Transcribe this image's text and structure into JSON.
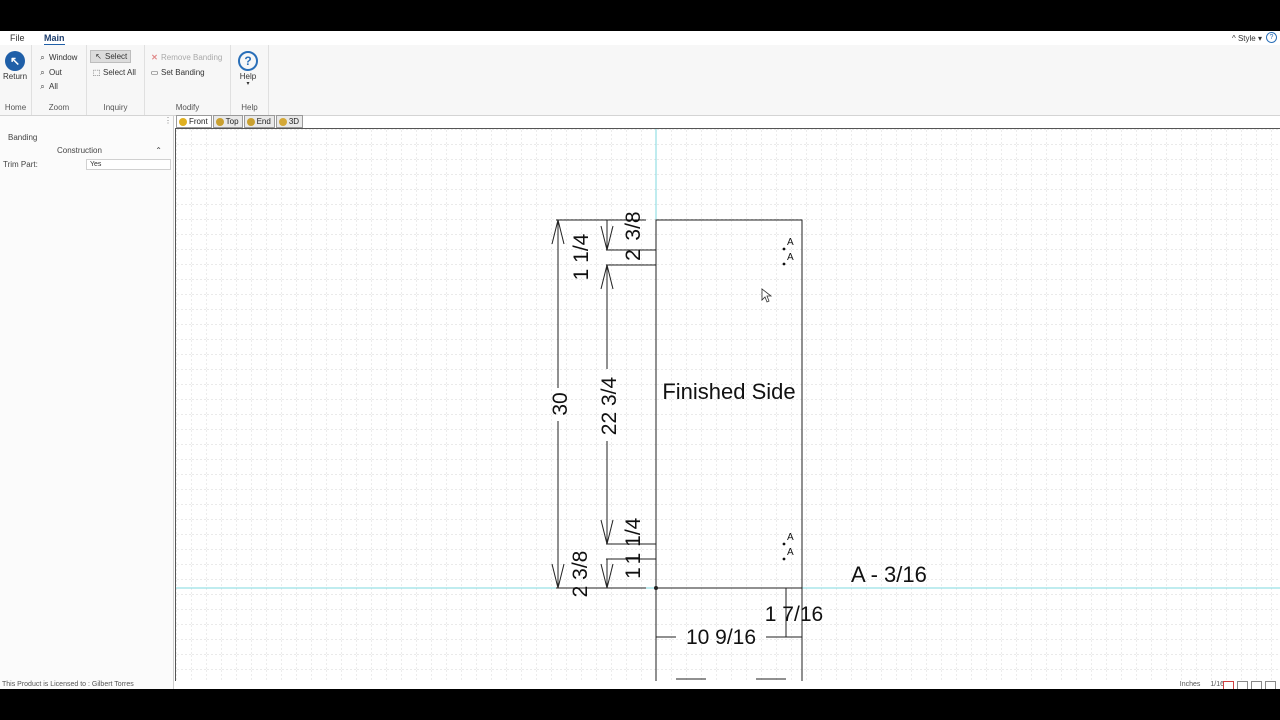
{
  "menu": {
    "file": "File",
    "main": "Main",
    "style": "Style"
  },
  "ribbon": {
    "home": {
      "return_label": "Return",
      "group_label": "Home"
    },
    "zoom": {
      "window": "Window",
      "out": "Out",
      "all": "All",
      "group_label": "Zoom"
    },
    "inquiry": {
      "select": "Select",
      "select_all": "Select All",
      "group_label": "Inquiry"
    },
    "modify": {
      "remove_banding": "Remove Banding",
      "set_banding": "Set Banding",
      "group_label": "Modify"
    },
    "help": {
      "help_label": "Help",
      "group_label": "Help"
    }
  },
  "panel": {
    "title": "Banding",
    "category": "Construction",
    "property_label": "Trim Part:",
    "property_value": "Yes"
  },
  "view_tabs": [
    "Front",
    "Top",
    "End",
    "3D"
  ],
  "drawing": {
    "part_label": "Finished Side",
    "banding_legend": "A - 3/16",
    "edge_marker": "A",
    "dimensions": {
      "overall_height": "30",
      "top_offset": "1 1/4",
      "bottom_offset": "2 3/8",
      "mid_span": "22 3/4",
      "top_small_a": "3/8",
      "top_small_b": "2",
      "bottom_small_a": "1 1/4",
      "bottom_small_b": "1",
      "horizontal_a": "10 9/16",
      "horizontal_b": "1 7/16"
    }
  },
  "status": {
    "license": "This Product is Licensed to : Gilbert Torres",
    "units": "Inches",
    "precision": "1/16"
  },
  "colors": {
    "accent": "#1f5fa8",
    "crosshair": "#7fd8df",
    "grid": "#c9c9c9"
  }
}
